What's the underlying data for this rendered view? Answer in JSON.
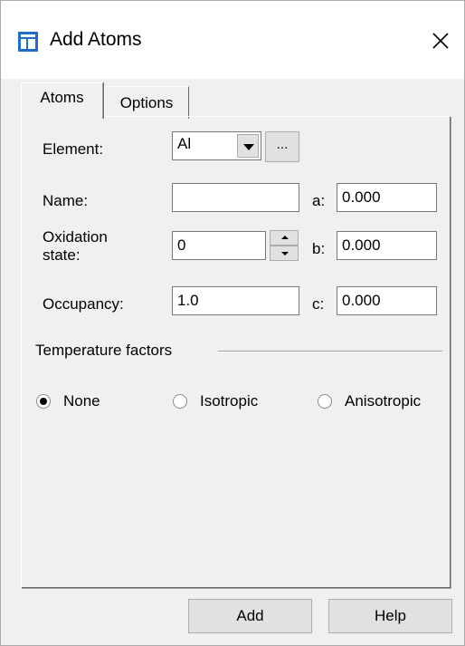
{
  "window": {
    "title": "Add Atoms",
    "icon": "app-window-icon",
    "close_glyph": "✕"
  },
  "tabs": [
    {
      "label": "Atoms",
      "active": true
    },
    {
      "label": "Options",
      "active": false
    }
  ],
  "atoms": {
    "element_label": "Element:",
    "element_value": "Al",
    "browse_label": "...",
    "name_label": "Name:",
    "name_value": "",
    "oxidation_label": "Oxidation\nstate:",
    "oxidation_value": "0",
    "occupancy_label": "Occupancy:",
    "occupancy_value": "1.0",
    "a_label": "a:",
    "a_value": "0.000",
    "b_label": "b:",
    "b_value": "0.000",
    "c_label": "c:",
    "c_value": "0.000"
  },
  "temperature": {
    "heading": "Temperature factors",
    "options": [
      {
        "label": "None",
        "checked": true
      },
      {
        "label": "Isotropic",
        "checked": false
      },
      {
        "label": "Anisotropic",
        "checked": false
      }
    ]
  },
  "buttons": {
    "add": "Add",
    "help": "Help"
  },
  "colors": {
    "face": "#f0f0f0",
    "button": "#e1e1e1",
    "icon_blue": "#1e6fc8"
  }
}
